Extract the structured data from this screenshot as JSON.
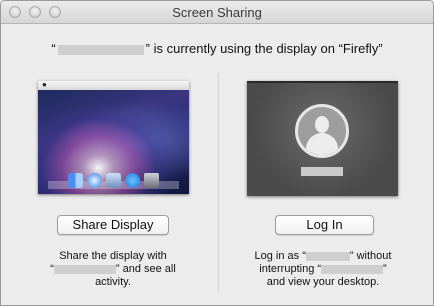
{
  "window": {
    "title": "Screen Sharing"
  },
  "message": {
    "prefix": "“",
    "suffix": "” is currently using the display on “Firefly”"
  },
  "share": {
    "button_label": "Share Display",
    "desc_line1": "Share the display with",
    "desc_line2_prefix": "“",
    "desc_line2_suffix": "” and see all",
    "desc_line3": "activity."
  },
  "login": {
    "button_label": "Log In",
    "desc_line1_prefix": "Log in as “",
    "desc_line1_suffix": "” without",
    "desc_line2_prefix": "interrupting “",
    "desc_line2_suffix": "”",
    "desc_line3": "and view your desktop."
  },
  "icons": {
    "apple": "apple-icon",
    "dock": [
      "finder-icon",
      "safari-icon",
      "mail-icon",
      "messages-icon",
      "trash-icon"
    ],
    "user": "user-silhouette-icon"
  }
}
